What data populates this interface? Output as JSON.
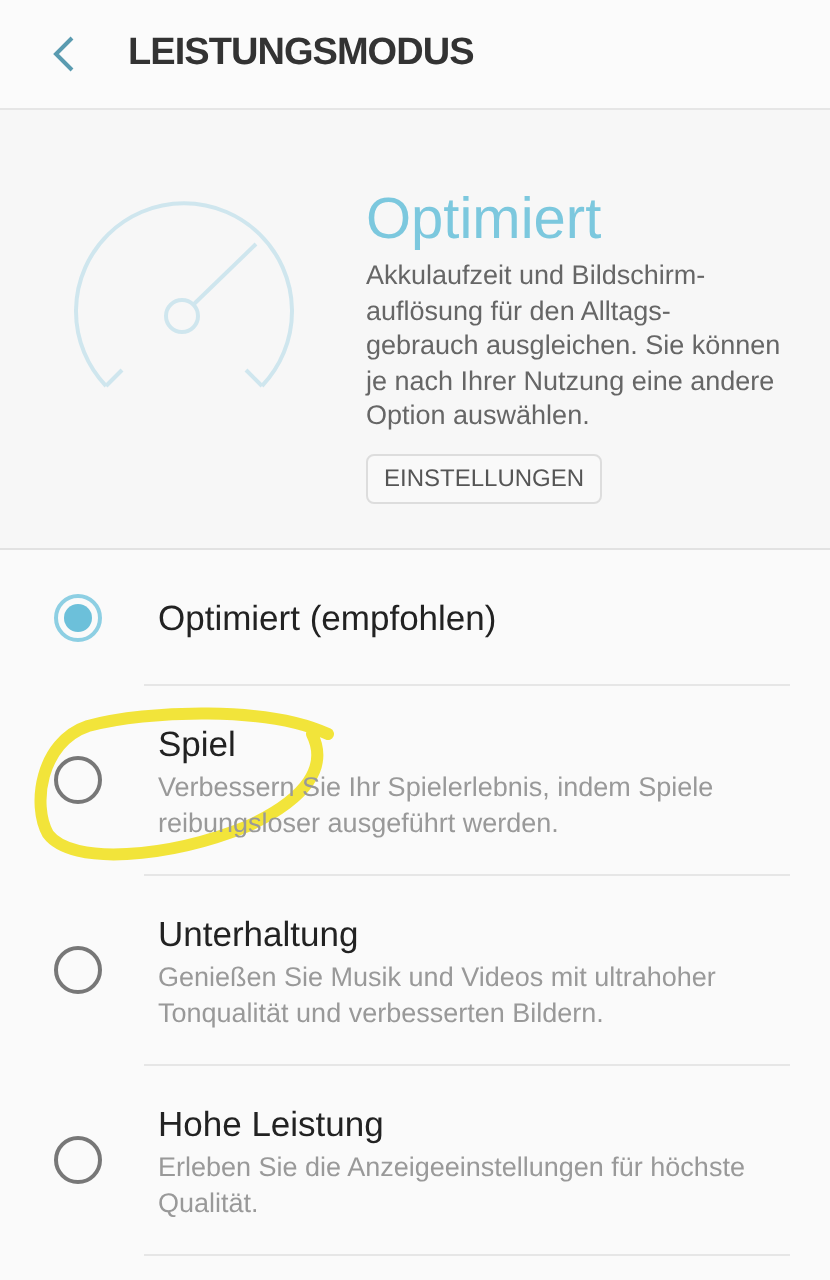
{
  "header": {
    "title": "LEISTUNGSMODUS"
  },
  "hero": {
    "title": "Optimiert",
    "description": "Akkulaufzeit und Bildschirm-auflösung für den Alltags-gebrauch ausgleichen. Sie können je nach Ihrer Nutzung eine andere Option auswählen.",
    "button": "EINSTELLUNGEN"
  },
  "modes": [
    {
      "title": "Optimiert (empfohlen)",
      "selected": true
    },
    {
      "title": "Spiel",
      "description": "Verbessern Sie Ihr Spielerlebnis, indem Spiele reibungsloser ausgeführt werden.",
      "selected": false,
      "annotated": true
    },
    {
      "title": "Unterhaltung",
      "description": "Genießen Sie Musik und Videos mit ultrahoher Tonqualität und verbesserten Bildern.",
      "selected": false
    },
    {
      "title": "Hohe Leistung",
      "description": "Erleben Sie die Anzeigeeinstellungen für höchste Qualität.",
      "selected": false
    }
  ]
}
